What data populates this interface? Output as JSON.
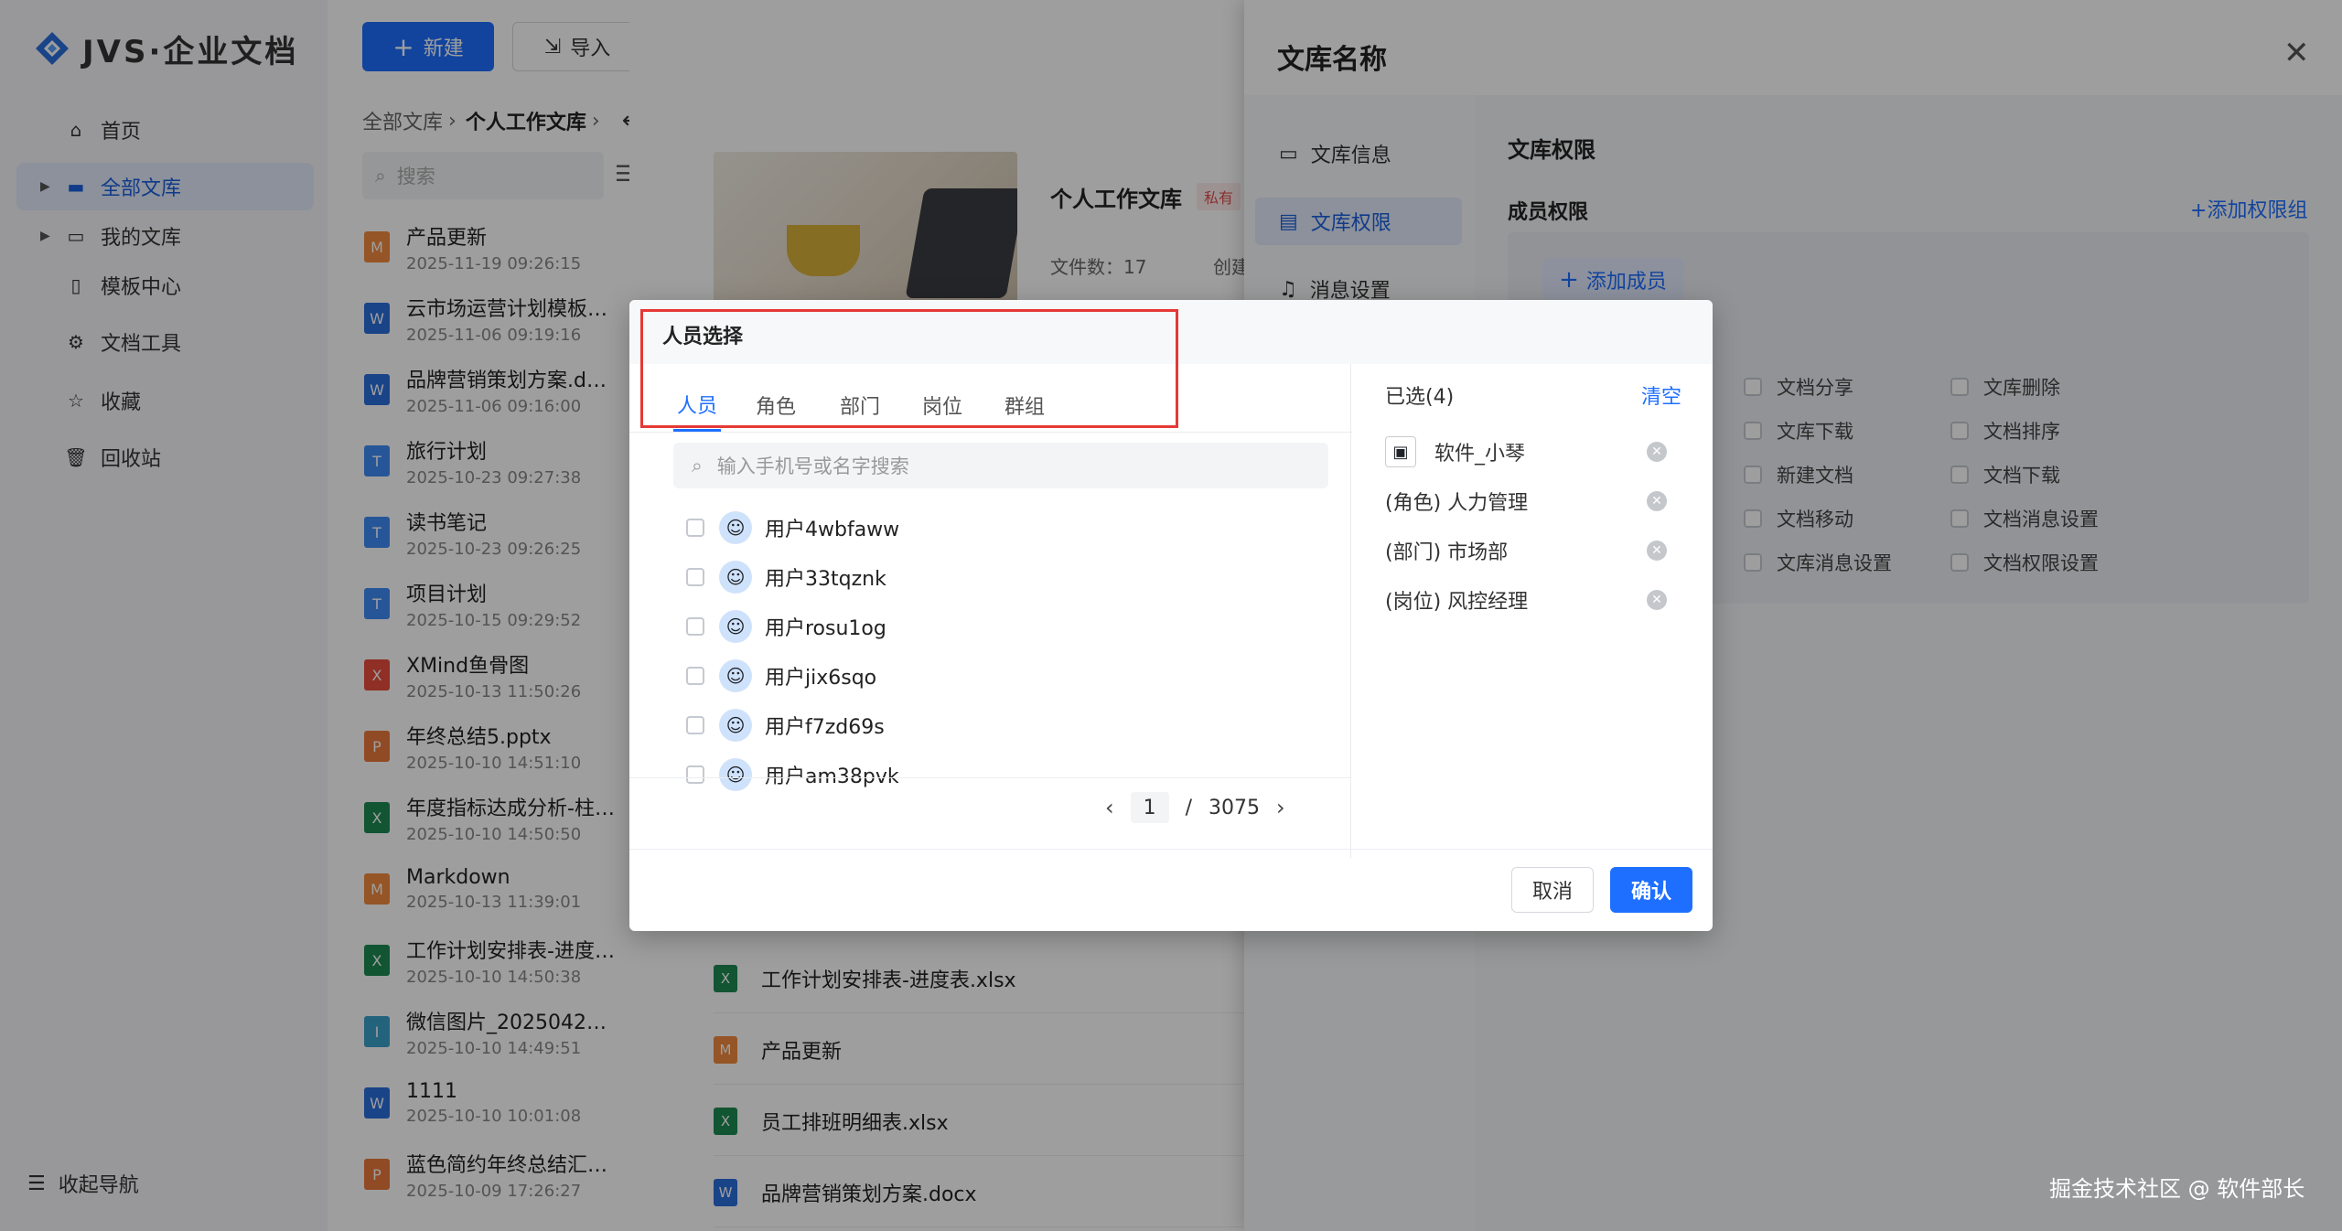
{
  "app": {
    "logo_text": "JVS·企业文档"
  },
  "nav": {
    "items": [
      {
        "label": "首页",
        "icon": "home-icon"
      },
      {
        "label": "全部文库",
        "icon": "folder-icon"
      },
      {
        "label": "我的文库",
        "icon": "folder-outline-icon"
      },
      {
        "label": "模板中心",
        "icon": "template-icon"
      },
      {
        "label": "文档工具",
        "icon": "tools-icon"
      },
      {
        "label": "收藏",
        "icon": "star-icon"
      },
      {
        "label": "回收站",
        "icon": "trash-icon"
      }
    ],
    "collapse_label": "收起导航"
  },
  "toolbar": {
    "new_label": "新建",
    "import_label": "导入"
  },
  "breadcrumb": {
    "root": "全部文库",
    "current": "个人工作文库"
  },
  "search": {
    "placeholder": "搜索"
  },
  "files": [
    {
      "name": "产品更新",
      "date": "2025-11-19 09:26:15",
      "type": "M"
    },
    {
      "name": "云市场运营计划模板…",
      "date": "2025-11-06 09:19:16",
      "type": "W"
    },
    {
      "name": "品牌营销策划方案.d…",
      "date": "2025-11-06 09:16:00",
      "type": "W"
    },
    {
      "name": "旅行计划",
      "date": "2025-10-23 09:27:38",
      "type": "T"
    },
    {
      "name": "读书笔记",
      "date": "2025-10-23 09:26:25",
      "type": "T"
    },
    {
      "name": "项目计划",
      "date": "2025-10-15 09:29:52",
      "type": "T"
    },
    {
      "name": "XMind鱼骨图",
      "date": "2025-10-13 11:50:26",
      "type": "X"
    },
    {
      "name": "年终总结5.pptx",
      "date": "2025-10-10 14:51:10",
      "type": "P"
    },
    {
      "name": "年度指标达成分析-柱…",
      "date": "2025-10-10 14:50:50",
      "type": "X"
    },
    {
      "name": "Markdown",
      "date": "2025-10-13 11:39:01",
      "type": "M"
    },
    {
      "name": "工作计划安排表-进度…",
      "date": "2025-10-10 14:50:38",
      "type": "X"
    },
    {
      "name": "微信图片_20250425…",
      "date": "2025-10-10 14:49:51",
      "type": "I"
    },
    {
      "name": "1111",
      "date": "2025-10-10 10:01:08",
      "type": "W"
    },
    {
      "name": "蓝色简约年终总结汇…",
      "date": "2025-10-09 17:26:27",
      "type": "P"
    }
  ],
  "library": {
    "title": "个人工作文库",
    "tag": "私有",
    "count_label": "文件数：17",
    "create_label": "创建"
  },
  "rows": [
    {
      "name": "工作计划安排表-进度表.xlsx",
      "type": "X"
    },
    {
      "name": "产品更新",
      "type": "M"
    },
    {
      "name": "员工排班明细表.xlsx",
      "type": "X"
    },
    {
      "name": "品牌营销策划方案.docx",
      "type": "W"
    }
  ],
  "drawer": {
    "title": "文库名称",
    "menu": [
      "文库信息",
      "文库权限",
      "消息设置"
    ],
    "perm_title": "文库权限",
    "member_title": "成员权限",
    "add_group": "添加权限组",
    "add_member": "添加成员",
    "permissions": [
      [
        "文档分享",
        "文库删除"
      ],
      [
        "文库下载",
        "文档排序"
      ],
      [
        "新建文档",
        "文档下载"
      ],
      [
        "文档移动",
        "文档消息设置"
      ],
      [
        "文库消息设置",
        "文档权限设置"
      ]
    ]
  },
  "modal": {
    "title": "人员选择",
    "tabs": [
      "人员",
      "角色",
      "部门",
      "岗位",
      "群组"
    ],
    "search_placeholder": "输入手机号或名字搜索",
    "users": [
      "用户4wbfaww",
      "用户33tqznk",
      "用户rosu1og",
      "用户jix6sqo",
      "用户f7zd69s",
      "用户am38pvk"
    ],
    "pager": {
      "current": "1",
      "sep": "/",
      "total": "3075"
    },
    "selected_label": "已选(4)",
    "clear_label": "清空",
    "selected": [
      "软件_小琴",
      "(角色) 人力管理",
      "(部门) 市场部",
      "(岗位) 风控经理"
    ],
    "cancel_label": "取消",
    "ok_label": "确认"
  },
  "watermark": "掘金技术社区 @ 软件部长",
  "colors": {
    "primary": "#1e6fff",
    "highlight": "#e53935"
  }
}
